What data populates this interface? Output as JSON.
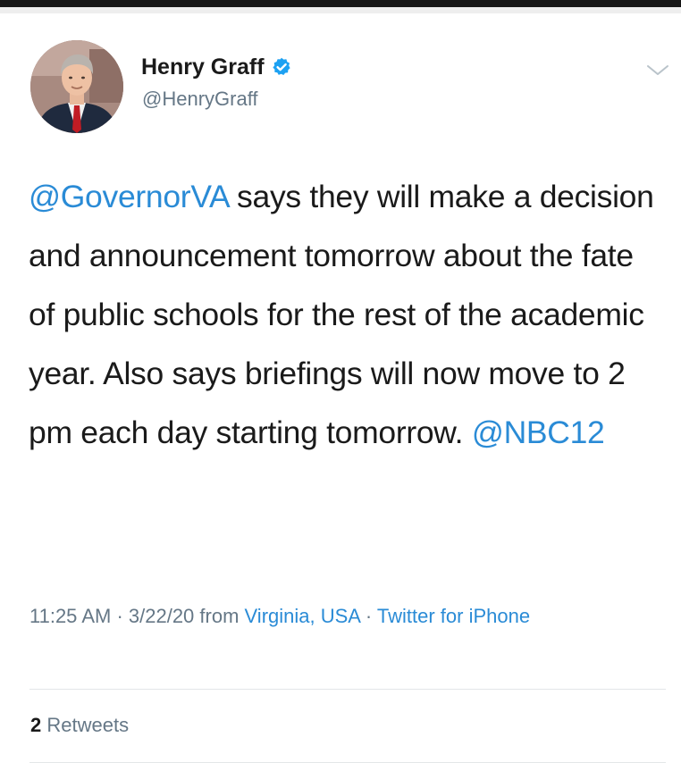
{
  "author": {
    "name": "Henry Graff",
    "handle": "@HenryGraff",
    "verified": true,
    "avatar_icon": "avatar-portrait-icon"
  },
  "tweet": {
    "segments": [
      {
        "type": "mention",
        "text": "@GovernorVA"
      },
      {
        "type": "text",
        "text": " says they will make a decision and announcement tomorrow about the fate of public schools for the rest of the academic year. Also says briefings will now move to 2 pm each day starting tomorrow. "
      },
      {
        "type": "mention",
        "text": "@NBC12"
      }
    ]
  },
  "meta": {
    "time": "11:25 AM",
    "sep1": " · ",
    "date": "3/22/20",
    "from_word": " from ",
    "location": "Virginia, USA",
    "sep2": " · ",
    "client": "Twitter for iPhone"
  },
  "stats": {
    "retweets_count": "2",
    "retweets_label": "Retweets"
  },
  "colors": {
    "link": "#2a8bd6",
    "secondary_text": "#657786",
    "primary_text": "#1a1a1a",
    "verified_badge": "#1da1f2"
  },
  "icons": {
    "verified": "verified-badge-icon",
    "menu": "chevron-down-icon"
  }
}
